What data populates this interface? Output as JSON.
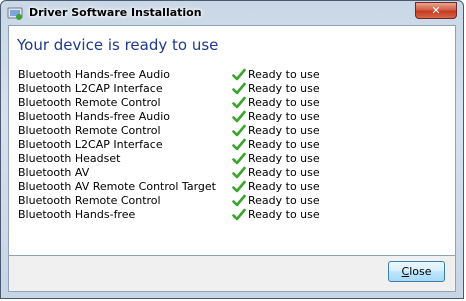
{
  "window": {
    "title": "Driver Software Installation",
    "close_glyph": "✕"
  },
  "main": {
    "heading": "Your device is ready to use",
    "devices": [
      {
        "name": "Bluetooth Hands-free Audio",
        "status": "Ready to use"
      },
      {
        "name": "Bluetooth L2CAP Interface",
        "status": "Ready to use"
      },
      {
        "name": "Bluetooth Remote Control",
        "status": "Ready to use"
      },
      {
        "name": "Bluetooth Hands-free Audio",
        "status": "Ready to use"
      },
      {
        "name": "Bluetooth Remote Control",
        "status": "Ready to use"
      },
      {
        "name": "Bluetooth L2CAP Interface",
        "status": "Ready to use"
      },
      {
        "name": "Bluetooth Headset",
        "status": "Ready to use"
      },
      {
        "name": "Bluetooth AV",
        "status": "Ready to use"
      },
      {
        "name": "Bluetooth AV Remote Control Target",
        "status": "Ready to use"
      },
      {
        "name": "Bluetooth Remote Control",
        "status": "Ready to use"
      },
      {
        "name": "Bluetooth Hands-free",
        "status": "Ready to use"
      }
    ],
    "status_icon": "green-check-icon"
  },
  "footer": {
    "close_button": {
      "accel": "C",
      "rest": "lose"
    }
  },
  "colors": {
    "heading": "#1e3a8a",
    "check": "#3aa52b"
  }
}
